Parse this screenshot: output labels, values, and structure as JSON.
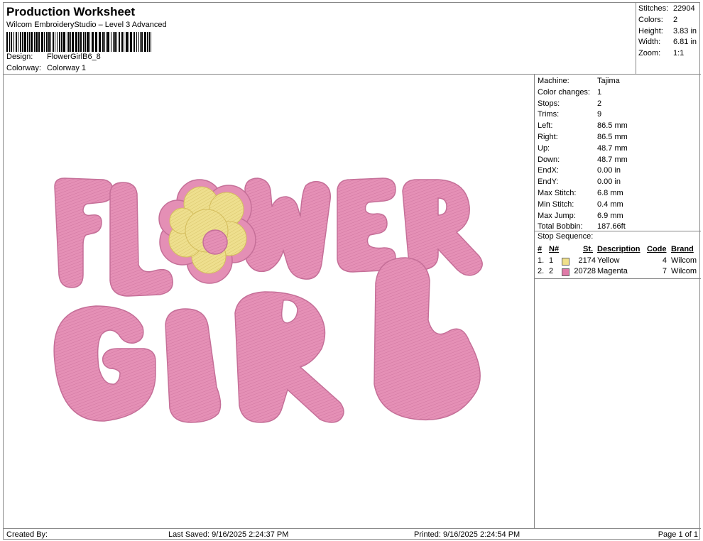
{
  "header": {
    "title": "Production Worksheet",
    "subtitle": "Wilcom EmbroideryStudio – Level 3 Advanced",
    "design_label": "Design:",
    "design_value": "FlowerGirlB6_8",
    "colorway_label": "Colorway:",
    "colorway_value": "Colorway 1"
  },
  "stats": [
    {
      "label": "Stitches:",
      "value": "22904"
    },
    {
      "label": "Colors:",
      "value": "2"
    },
    {
      "label": "Height:",
      "value": "3.83 in"
    },
    {
      "label": "Width:",
      "value": "6.81 in"
    },
    {
      "label": "Zoom:",
      "value": "1:1"
    }
  ],
  "machine_info": [
    {
      "label": "Machine:",
      "value": "Tajima"
    },
    {
      "label": "Color changes:",
      "value": "1"
    },
    {
      "label": "Stops:",
      "value": "2"
    },
    {
      "label": "Trims:",
      "value": "9"
    },
    {
      "label": "Left:",
      "value": "86.5 mm"
    },
    {
      "label": "Right:",
      "value": "86.5 mm"
    },
    {
      "label": "Up:",
      "value": "48.7 mm"
    },
    {
      "label": "Down:",
      "value": "48.7 mm"
    },
    {
      "label": "EndX:",
      "value": "0.00 in"
    },
    {
      "label": "EndY:",
      "value": "0.00 in"
    },
    {
      "label": "Max Stitch:",
      "value": "6.8 mm"
    },
    {
      "label": "Min Stitch:",
      "value": "0.4 mm"
    },
    {
      "label": "Max Jump:",
      "value": "6.9 mm"
    },
    {
      "label": "Total Bobbin:",
      "value": "187.66ft"
    }
  ],
  "stop_sequence": {
    "label": "Stop Sequence:",
    "columns": {
      "num": "#",
      "needle": "N#",
      "stitches": "St.",
      "description": "Description",
      "code": "Code",
      "brand": "Brand"
    },
    "rows": [
      {
        "num": "1.",
        "needle": "1",
        "color": "#f0e08a",
        "stitches": "2174",
        "description": "Yellow",
        "code": "4",
        "brand": "Wilcom"
      },
      {
        "num": "2.",
        "needle": "2",
        "color": "#e07aa8",
        "stitches": "20728",
        "description": "Magenta",
        "code": "7",
        "brand": "Wilcom"
      }
    ]
  },
  "design": {
    "pink": "#e48fb5",
    "pink_dark": "#c9709a",
    "yellow": "#eede8c",
    "outline": "#d77aa6"
  },
  "footer": {
    "created_by": "Created By:",
    "last_saved": "Last Saved: 9/16/2025 2:24:37 PM",
    "printed": "Printed: 9/16/2025 2:24:54 PM",
    "page": "Page 1 of 1"
  }
}
